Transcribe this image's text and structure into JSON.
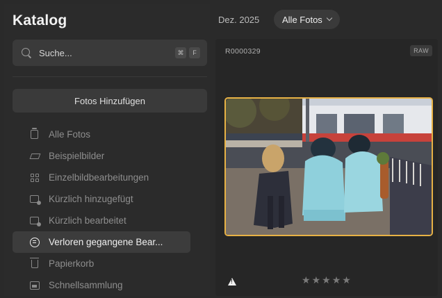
{
  "sidebar": {
    "title": "Katalog",
    "search": {
      "placeholder": "Suche...",
      "shortcut_modifier": "⌘",
      "shortcut_key": "F"
    },
    "add_button_label": "Fotos Hinzufügen",
    "items": [
      {
        "label": "Alle Fotos",
        "icon": "photo-stack-icon",
        "active": false
      },
      {
        "label": "Beispielbilder",
        "icon": "graduation-cap-icon",
        "active": false
      },
      {
        "label": "Einzelbildbearbeitungen",
        "icon": "grid-icon",
        "active": false
      },
      {
        "label": "Kürzlich hinzugefügt",
        "icon": "recently-added-icon",
        "active": false
      },
      {
        "label": "Kürzlich bearbeitet",
        "icon": "recently-edited-icon",
        "active": false
      },
      {
        "label": "Verloren gegangene Bear...",
        "icon": "lost-edits-icon",
        "active": true
      },
      {
        "label": "Papierkorb",
        "icon": "trash-icon",
        "active": false
      },
      {
        "label": "Schnellsammlung",
        "icon": "quick-collection-icon",
        "active": false
      }
    ]
  },
  "toolbar": {
    "date_label": "Dez. 2025",
    "filter_label": "Alle Fotos"
  },
  "photo_card": {
    "file_name": "R0000329",
    "format_badge": "RAW",
    "rating": 0,
    "max_rating": 5,
    "selected_border_color": "#e8b245"
  }
}
